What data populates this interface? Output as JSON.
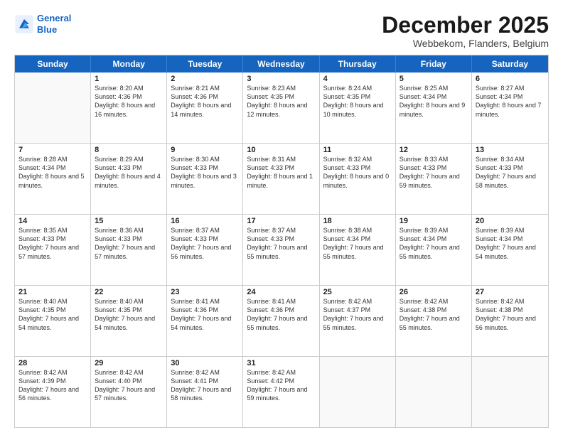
{
  "logo": {
    "line1": "General",
    "line2": "Blue"
  },
  "title": "December 2025",
  "subtitle": "Webbekom, Flanders, Belgium",
  "header_days": [
    "Sunday",
    "Monday",
    "Tuesday",
    "Wednesday",
    "Thursday",
    "Friday",
    "Saturday"
  ],
  "rows": [
    [
      {
        "day": "",
        "empty": true
      },
      {
        "day": "1",
        "sunrise": "8:20 AM",
        "sunset": "4:36 PM",
        "daylight": "8 hours and 16 minutes."
      },
      {
        "day": "2",
        "sunrise": "8:21 AM",
        "sunset": "4:36 PM",
        "daylight": "8 hours and 14 minutes."
      },
      {
        "day": "3",
        "sunrise": "8:23 AM",
        "sunset": "4:35 PM",
        "daylight": "8 hours and 12 minutes."
      },
      {
        "day": "4",
        "sunrise": "8:24 AM",
        "sunset": "4:35 PM",
        "daylight": "8 hours and 10 minutes."
      },
      {
        "day": "5",
        "sunrise": "8:25 AM",
        "sunset": "4:34 PM",
        "daylight": "8 hours and 9 minutes."
      },
      {
        "day": "6",
        "sunrise": "8:27 AM",
        "sunset": "4:34 PM",
        "daylight": "8 hours and 7 minutes."
      }
    ],
    [
      {
        "day": "7",
        "sunrise": "8:28 AM",
        "sunset": "4:34 PM",
        "daylight": "8 hours and 5 minutes."
      },
      {
        "day": "8",
        "sunrise": "8:29 AM",
        "sunset": "4:33 PM",
        "daylight": "8 hours and 4 minutes."
      },
      {
        "day": "9",
        "sunrise": "8:30 AM",
        "sunset": "4:33 PM",
        "daylight": "8 hours and 3 minutes."
      },
      {
        "day": "10",
        "sunrise": "8:31 AM",
        "sunset": "4:33 PM",
        "daylight": "8 hours and 1 minute."
      },
      {
        "day": "11",
        "sunrise": "8:32 AM",
        "sunset": "4:33 PM",
        "daylight": "8 hours and 0 minutes."
      },
      {
        "day": "12",
        "sunrise": "8:33 AM",
        "sunset": "4:33 PM",
        "daylight": "7 hours and 59 minutes."
      },
      {
        "day": "13",
        "sunrise": "8:34 AM",
        "sunset": "4:33 PM",
        "daylight": "7 hours and 58 minutes."
      }
    ],
    [
      {
        "day": "14",
        "sunrise": "8:35 AM",
        "sunset": "4:33 PM",
        "daylight": "7 hours and 57 minutes."
      },
      {
        "day": "15",
        "sunrise": "8:36 AM",
        "sunset": "4:33 PM",
        "daylight": "7 hours and 57 minutes."
      },
      {
        "day": "16",
        "sunrise": "8:37 AM",
        "sunset": "4:33 PM",
        "daylight": "7 hours and 56 minutes."
      },
      {
        "day": "17",
        "sunrise": "8:37 AM",
        "sunset": "4:33 PM",
        "daylight": "7 hours and 55 minutes."
      },
      {
        "day": "18",
        "sunrise": "8:38 AM",
        "sunset": "4:34 PM",
        "daylight": "7 hours and 55 minutes."
      },
      {
        "day": "19",
        "sunrise": "8:39 AM",
        "sunset": "4:34 PM",
        "daylight": "7 hours and 55 minutes."
      },
      {
        "day": "20",
        "sunrise": "8:39 AM",
        "sunset": "4:34 PM",
        "daylight": "7 hours and 54 minutes."
      }
    ],
    [
      {
        "day": "21",
        "sunrise": "8:40 AM",
        "sunset": "4:35 PM",
        "daylight": "7 hours and 54 minutes."
      },
      {
        "day": "22",
        "sunrise": "8:40 AM",
        "sunset": "4:35 PM",
        "daylight": "7 hours and 54 minutes."
      },
      {
        "day": "23",
        "sunrise": "8:41 AM",
        "sunset": "4:36 PM",
        "daylight": "7 hours and 54 minutes."
      },
      {
        "day": "24",
        "sunrise": "8:41 AM",
        "sunset": "4:36 PM",
        "daylight": "7 hours and 55 minutes."
      },
      {
        "day": "25",
        "sunrise": "8:42 AM",
        "sunset": "4:37 PM",
        "daylight": "7 hours and 55 minutes."
      },
      {
        "day": "26",
        "sunrise": "8:42 AM",
        "sunset": "4:38 PM",
        "daylight": "7 hours and 55 minutes."
      },
      {
        "day": "27",
        "sunrise": "8:42 AM",
        "sunset": "4:38 PM",
        "daylight": "7 hours and 56 minutes."
      }
    ],
    [
      {
        "day": "28",
        "sunrise": "8:42 AM",
        "sunset": "4:39 PM",
        "daylight": "7 hours and 56 minutes."
      },
      {
        "day": "29",
        "sunrise": "8:42 AM",
        "sunset": "4:40 PM",
        "daylight": "7 hours and 57 minutes."
      },
      {
        "day": "30",
        "sunrise": "8:42 AM",
        "sunset": "4:41 PM",
        "daylight": "7 hours and 58 minutes."
      },
      {
        "day": "31",
        "sunrise": "8:42 AM",
        "sunset": "4:42 PM",
        "daylight": "7 hours and 59 minutes."
      },
      {
        "day": "",
        "empty": true
      },
      {
        "day": "",
        "empty": true
      },
      {
        "day": "",
        "empty": true
      }
    ]
  ]
}
